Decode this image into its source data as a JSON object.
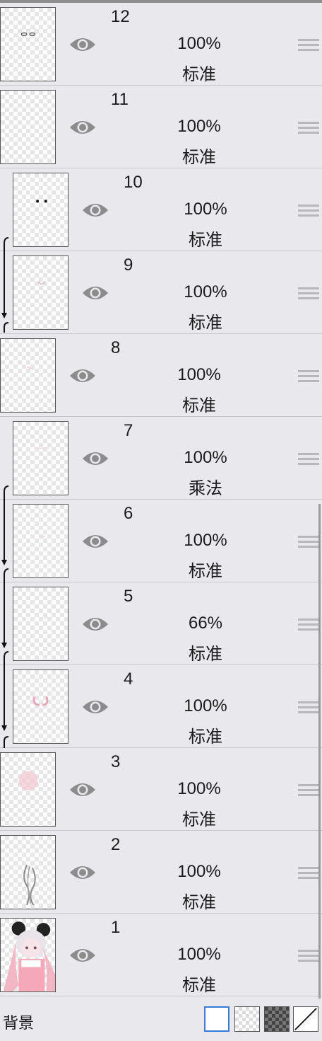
{
  "layers": [
    {
      "number": "12",
      "opacity": "100%",
      "blend": "标准",
      "visible": true,
      "clipped": false
    },
    {
      "number": "11",
      "opacity": "100%",
      "blend": "标准",
      "visible": true,
      "clipped": false
    },
    {
      "number": "10",
      "opacity": "100%",
      "blend": "标准",
      "visible": true,
      "clipped": true
    },
    {
      "number": "9",
      "opacity": "100%",
      "blend": "标准",
      "visible": true,
      "clipped": true
    },
    {
      "number": "8",
      "opacity": "100%",
      "blend": "标准",
      "visible": true,
      "clipped": false
    },
    {
      "number": "7",
      "opacity": "100%",
      "blend": "乘法",
      "visible": true,
      "clipped": true
    },
    {
      "number": "6",
      "opacity": "100%",
      "blend": "标准",
      "visible": true,
      "clipped": true
    },
    {
      "number": "5",
      "opacity": "66%",
      "blend": "标准",
      "visible": true,
      "clipped": true
    },
    {
      "number": "4",
      "opacity": "100%",
      "blend": "标准",
      "visible": true,
      "clipped": true
    },
    {
      "number": "3",
      "opacity": "100%",
      "blend": "标准",
      "visible": true,
      "clipped": false
    },
    {
      "number": "2",
      "opacity": "100%",
      "blend": "标准",
      "visible": true,
      "clipped": false
    },
    {
      "number": "1",
      "opacity": "100%",
      "blend": "标准",
      "visible": true,
      "clipped": false
    }
  ],
  "background": {
    "label": "背景",
    "options": [
      "white",
      "transparent",
      "dark-checker",
      "none"
    ],
    "selected": "white"
  },
  "icons": {
    "visibility": "eye-icon",
    "reorder": "drag-handle-icon",
    "clip": "clipping-arrow-icon"
  },
  "colors": {
    "panel_bg": "#e9e8ec",
    "eye": "#8c8c8c",
    "selected_border": "#3a7bd5"
  }
}
